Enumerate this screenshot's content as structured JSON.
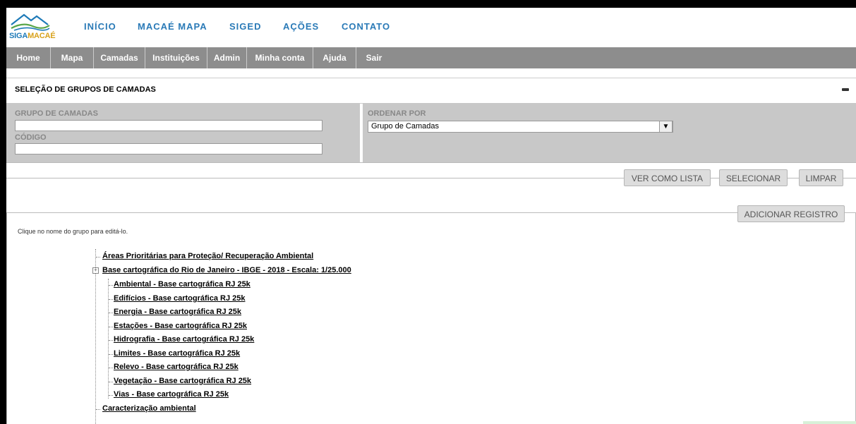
{
  "logo": {
    "brand_part1": "SIGA",
    "brand_part2": "MACAÉ",
    "colors": {
      "blue": "#1d7ab8",
      "gold": "#d8a21c",
      "green": "#5aa64a"
    }
  },
  "topnav": [
    "INÍCIO",
    "MACAÉ MAPA",
    "SIGED",
    "AÇÕES",
    "CONTATO"
  ],
  "menubar": [
    "Home",
    "Mapa",
    "Camadas",
    "Instituições",
    "Admin",
    "Minha conta",
    "Ajuda",
    "Sair"
  ],
  "panel": {
    "title": "SELEÇÃO DE GRUPOS DE CAMADAS",
    "group_label": "GRUPO DE CAMADAS",
    "group_value": "",
    "code_label": "CÓDIGO",
    "code_value": "",
    "order_label": "ORDENAR POR",
    "order_value": "Grupo de Camadas"
  },
  "buttons": {
    "list": "VER COMO LISTA",
    "select": "SELECIONAR",
    "clear": "LIMPAR",
    "add": "ADICIONAR REGISTRO"
  },
  "hint": "Clique no nome do grupo para editá-lo.",
  "tree": {
    "root1": "Áreas Prioritárias para Proteção/ Recuperação Ambiental",
    "root2": "Base cartográfica do Rio de Janeiro - IBGE - 2018 - Escala: 1/25.000",
    "children": [
      "Ambiental - Base cartográfica RJ 25k",
      "Edifícios - Base cartográfica RJ 25k",
      "Energia - Base cartográfica RJ 25k",
      "Estações - Base cartográfica RJ 25k",
      "Hidrografia - Base cartográfica RJ 25k",
      "Limites - Base cartográfica RJ 25k",
      "Relevo - Base cartográfica RJ 25k",
      "Vegetação - Base cartográfica RJ 25k",
      "Vias - Base cartográfica RJ 25k"
    ],
    "root3": "Caracterização ambiental"
  }
}
